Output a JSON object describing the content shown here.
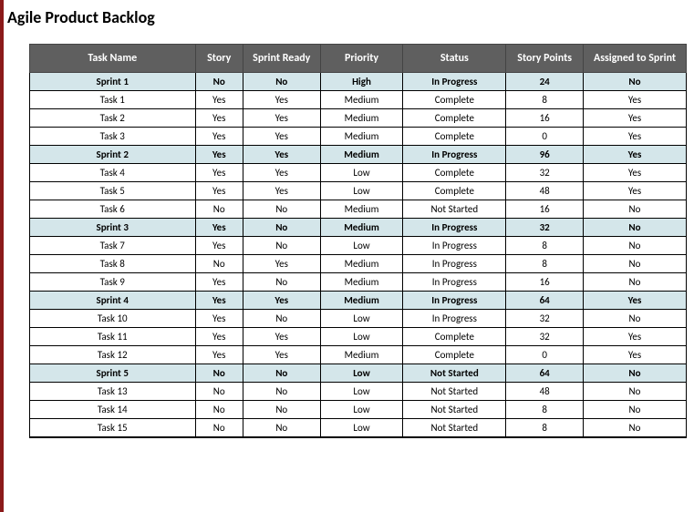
{
  "title": "Agile Product Backlog",
  "headers": {
    "task": "Task Name",
    "story": "Story",
    "ready": "Sprint Ready",
    "priority": "Priority",
    "status": "Status",
    "points": "Story Points",
    "assigned": "Assigned to Sprint"
  },
  "chart_data": {
    "type": "table",
    "rows": [
      {
        "task": "Sprint 1",
        "story": "No",
        "ready": "No",
        "priority": "High",
        "status": "In Progress",
        "points": "24",
        "assigned": "No",
        "sprint": true
      },
      {
        "task": "Task 1",
        "story": "Yes",
        "ready": "Yes",
        "priority": "Medium",
        "status": "Complete",
        "points": "8",
        "assigned": "Yes",
        "sprint": false
      },
      {
        "task": "Task 2",
        "story": "Yes",
        "ready": "Yes",
        "priority": "Medium",
        "status": "Complete",
        "points": "16",
        "assigned": "Yes",
        "sprint": false
      },
      {
        "task": "Task 3",
        "story": "Yes",
        "ready": "Yes",
        "priority": "Medium",
        "status": "Complete",
        "points": "0",
        "assigned": "Yes",
        "sprint": false
      },
      {
        "task": "Sprint 2",
        "story": "Yes",
        "ready": "Yes",
        "priority": "Medium",
        "status": "In Progress",
        "points": "96",
        "assigned": "Yes",
        "sprint": true
      },
      {
        "task": "Task 4",
        "story": "Yes",
        "ready": "Yes",
        "priority": "Low",
        "status": "Complete",
        "points": "32",
        "assigned": "Yes",
        "sprint": false
      },
      {
        "task": "Task 5",
        "story": "Yes",
        "ready": "Yes",
        "priority": "Low",
        "status": "Complete",
        "points": "48",
        "assigned": "Yes",
        "sprint": false
      },
      {
        "task": "Task 6",
        "story": "No",
        "ready": "No",
        "priority": "Medium",
        "status": "Not Started",
        "points": "16",
        "assigned": "No",
        "sprint": false
      },
      {
        "task": "Sprint 3",
        "story": "Yes",
        "ready": "No",
        "priority": "Medium",
        "status": "In Progress",
        "points": "32",
        "assigned": "No",
        "sprint": true
      },
      {
        "task": "Task 7",
        "story": "Yes",
        "ready": "No",
        "priority": "Low",
        "status": "In Progress",
        "points": "8",
        "assigned": "No",
        "sprint": false
      },
      {
        "task": "Task 8",
        "story": "No",
        "ready": "Yes",
        "priority": "Medium",
        "status": "In Progress",
        "points": "8",
        "assigned": "No",
        "sprint": false
      },
      {
        "task": "Task 9",
        "story": "Yes",
        "ready": "No",
        "priority": "Medium",
        "status": "In Progress",
        "points": "16",
        "assigned": "No",
        "sprint": false
      },
      {
        "task": "Sprint 4",
        "story": "Yes",
        "ready": "Yes",
        "priority": "Medium",
        "status": "In Progress",
        "points": "64",
        "assigned": "Yes",
        "sprint": true
      },
      {
        "task": "Task 10",
        "story": "Yes",
        "ready": "No",
        "priority": "Low",
        "status": "In Progress",
        "points": "32",
        "assigned": "No",
        "sprint": false
      },
      {
        "task": "Task 11",
        "story": "Yes",
        "ready": "Yes",
        "priority": "Low",
        "status": "Complete",
        "points": "32",
        "assigned": "Yes",
        "sprint": false
      },
      {
        "task": "Task 12",
        "story": "Yes",
        "ready": "Yes",
        "priority": "Medium",
        "status": "Complete",
        "points": "0",
        "assigned": "Yes",
        "sprint": false
      },
      {
        "task": "Sprint 5",
        "story": "No",
        "ready": "No",
        "priority": "Low",
        "status": "Not Started",
        "points": "64",
        "assigned": "No",
        "sprint": true
      },
      {
        "task": "Task 13",
        "story": "No",
        "ready": "No",
        "priority": "Low",
        "status": "Not Started",
        "points": "48",
        "assigned": "No",
        "sprint": false
      },
      {
        "task": "Task 14",
        "story": "No",
        "ready": "No",
        "priority": "Low",
        "status": "Not Started",
        "points": "8",
        "assigned": "No",
        "sprint": false
      },
      {
        "task": "Task 15",
        "story": "No",
        "ready": "No",
        "priority": "Low",
        "status": "Not Started",
        "points": "8",
        "assigned": "No",
        "sprint": false
      }
    ]
  }
}
